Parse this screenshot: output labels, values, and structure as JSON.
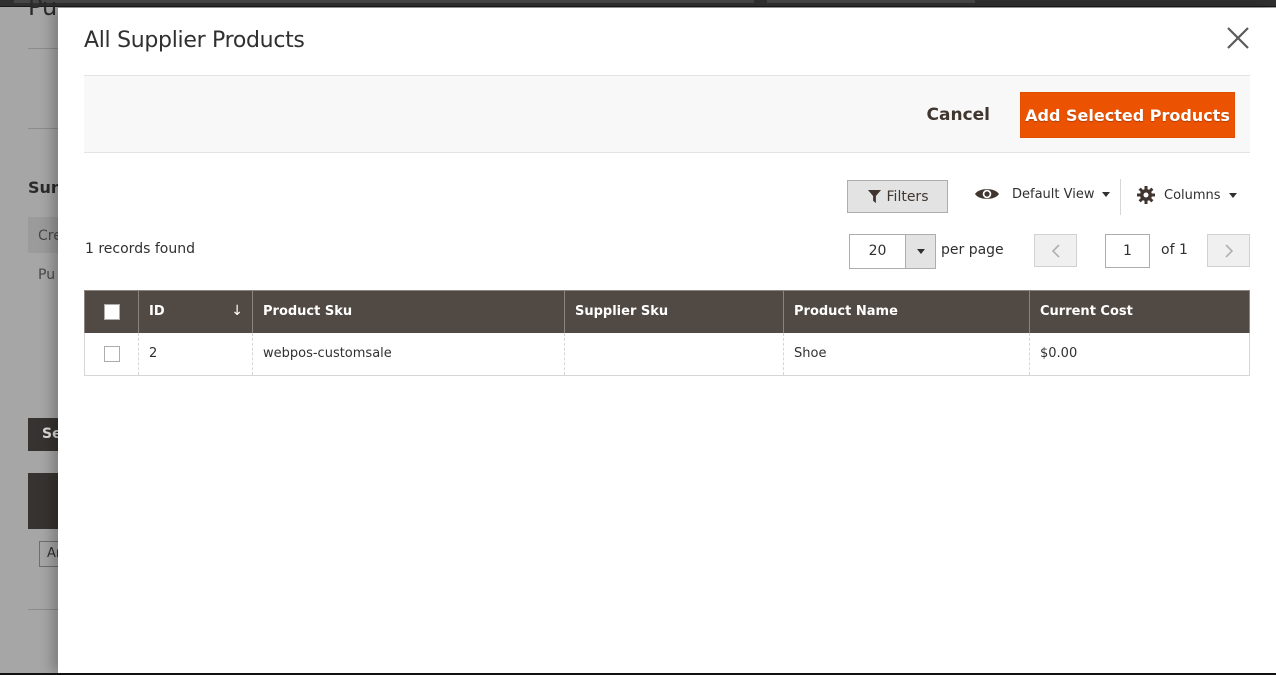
{
  "background": {
    "title_fragment": "Pu",
    "summary_fragment": "Sun",
    "create_fragment": "Cre",
    "purchase_fragment": "Pu",
    "button_fragment": "Se",
    "input_fragment": "Ar"
  },
  "modal": {
    "title": "All Supplier Products",
    "close_label": "Close",
    "actions": {
      "cancel_label": "Cancel",
      "add_label": "Add Selected Products",
      "add_color": "#eb5202"
    },
    "toolbar": {
      "filters_label": "Filters",
      "view_label": "Default View",
      "columns_label": "Columns",
      "records_found": "1 records found",
      "per_page_value": "20",
      "per_page_label": "per page",
      "current_page": "1",
      "page_of": "of 1"
    },
    "grid": {
      "header_color": "#514943",
      "columns": [
        "ID",
        "Product Sku",
        "Supplier Sku",
        "Product Name",
        "Current Cost"
      ],
      "sort_indicator": "↓",
      "rows": [
        {
          "id": "2",
          "product_sku": "webpos-customsale",
          "supplier_sku": "",
          "product_name": "Shoe",
          "current_cost": "$0.00"
        }
      ]
    }
  }
}
